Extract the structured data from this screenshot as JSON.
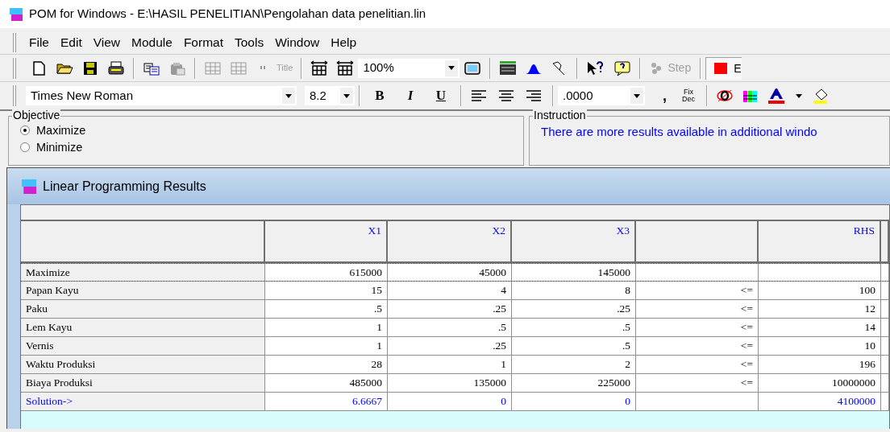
{
  "window": {
    "title": "POM for Windows - E:\\HASIL PENELITIAN\\Pengolahan data penelitian.lin"
  },
  "menu": [
    "File",
    "Edit",
    "View",
    "Module",
    "Format",
    "Tools",
    "Window",
    "Help"
  ],
  "toolbar": {
    "title_button": {
      "label": "Title",
      "disabled": true
    },
    "zoom": "100%",
    "step_button": {
      "label": "Step",
      "disabled": true
    },
    "cut_button": "E"
  },
  "format_bar": {
    "font": "Times New Roman",
    "size": "8.2",
    "bold": "B",
    "italic": "I",
    "underline": "U",
    "decimals": ".0000",
    "comma": ",",
    "fix_dec": "Fix Dec"
  },
  "objective": {
    "title": "Objective",
    "options": [
      {
        "label": "Maximize",
        "selected": true
      },
      {
        "label": "Minimize",
        "selected": false
      }
    ]
  },
  "instruction": {
    "title": "Instruction",
    "text": "There are more results available in additional windo"
  },
  "results": {
    "title": "Linear Programming Results",
    "columns": [
      "",
      "X1",
      "X2",
      "X3",
      "",
      "RHS"
    ],
    "rows": [
      {
        "kind": "objective",
        "cells": [
          "Maximize",
          "615000",
          "45000",
          "145000",
          "",
          ""
        ]
      },
      {
        "kind": "constraint",
        "cells": [
          "Papan Kayu",
          "15",
          "4",
          "8",
          "<=",
          "100"
        ]
      },
      {
        "kind": "constraint",
        "cells": [
          "Paku",
          ".5",
          ".25",
          ".25",
          "<=",
          "12"
        ]
      },
      {
        "kind": "constraint",
        "cells": [
          "Lem Kayu",
          "1",
          ".5",
          ".5",
          "<=",
          "14"
        ]
      },
      {
        "kind": "constraint",
        "cells": [
          "Vernis",
          "1",
          ".25",
          ".5",
          "<=",
          "10"
        ]
      },
      {
        "kind": "constraint",
        "cells": [
          "Waktu Produksi",
          "28",
          "1",
          "2",
          "<=",
          "196"
        ]
      },
      {
        "kind": "constraint",
        "cells": [
          "Biaya Produksi",
          "485000",
          "135000",
          "225000",
          "<=",
          "10000000"
        ]
      },
      {
        "kind": "solution",
        "cells": [
          "Solution->",
          "6.6667",
          "0",
          "0",
          "",
          "4100000"
        ]
      }
    ]
  }
}
